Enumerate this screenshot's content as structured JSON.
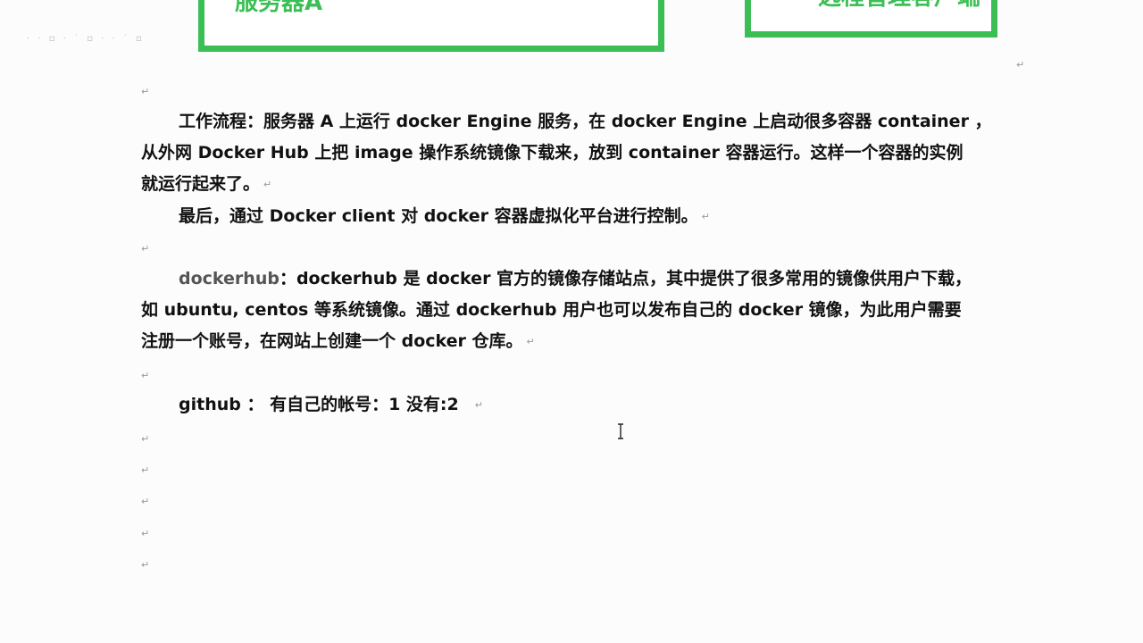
{
  "diagram": {
    "box_a_label": "服务器A",
    "box_b_label": "远程管理客户端"
  },
  "para_mark": "↵",
  "workflow": {
    "line1": "工作流程：服务器 A 上运行 docker Engine  服务，在 docker Engine 上启动很多容器 container  ，",
    "line2": "从外网 Docker Hub 上把 image 操作系统镜像下载来，放到 container 容器运行。这样一个容器的实例",
    "line3": "就运行起来了。"
  },
  "final": {
    "line1": "最后，通过 Docker  client  对 docker  容器虚拟化平台进行控制。"
  },
  "dockerhub": {
    "term": "dockerhub",
    "line1_rest": "：dockerhub 是 docker 官方的镜像存储站点，其中提供了很多常用的镜像供用户下载，",
    "line2": "如 ubuntu,  centos 等系统镜像。通过 dockerhub 用户也可以发布自己的 docker 镜像，为此用户需要",
    "line3": "注册一个账号，在网站上创建一个 docker 仓库。"
  },
  "github": {
    "line": "github  ：  有自己的帐号：1    没有:2"
  }
}
